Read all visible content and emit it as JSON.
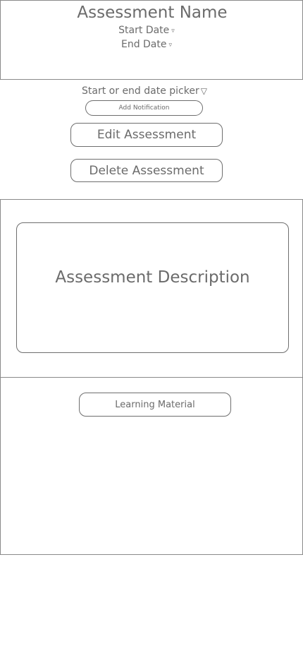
{
  "header": {
    "title": "Assessment Name",
    "start_date_label": "Start Date",
    "end_date_label": "End Date",
    "dropdown_glyph": "▿"
  },
  "controls": {
    "date_picker_label": "Start or end date picker",
    "date_picker_glyph": "▽",
    "add_notification_label": "Add Notification",
    "edit_label": "Edit Assessment",
    "delete_label": "Delete Assessment"
  },
  "description": {
    "text": "Assessment Description"
  },
  "materials": {
    "button_label": "Learning Material"
  }
}
